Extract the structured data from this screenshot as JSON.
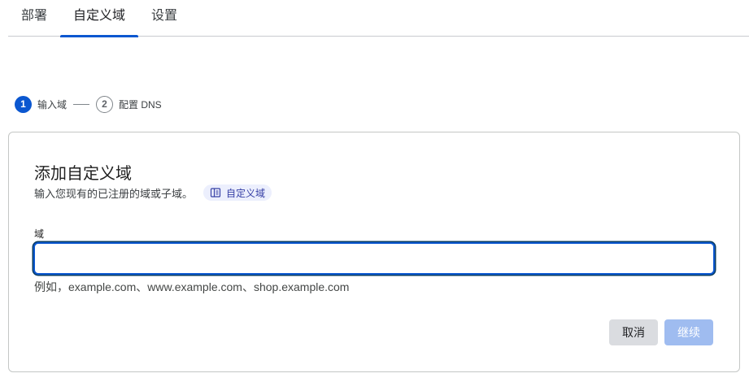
{
  "tabs": [
    {
      "label": "部署"
    },
    {
      "label": "自定义域"
    },
    {
      "label": "设置"
    }
  ],
  "active_tab": "自定义域",
  "stepper": {
    "steps": [
      {
        "number": "1",
        "label": "输入域",
        "state": "active"
      },
      {
        "number": "2",
        "label": "配置 DNS",
        "state": "inactive"
      }
    ]
  },
  "card": {
    "title": "添加自定义域",
    "description": "输入您现有的已注册的域或子域。",
    "help_chip": {
      "label": "自定义域",
      "icon": "book-icon"
    },
    "field": {
      "label": "域",
      "value": "",
      "placeholder": "",
      "hint": "例如，example.com、www.example.com、shop.example.com"
    },
    "buttons": {
      "cancel_label": "取消",
      "continue_label": "继续"
    }
  },
  "colors": {
    "accent": "#0b57d0",
    "continue_disabled": "#9fbcf0",
    "cancel_bg": "#dadce0",
    "chip_bg": "#eceffd"
  }
}
